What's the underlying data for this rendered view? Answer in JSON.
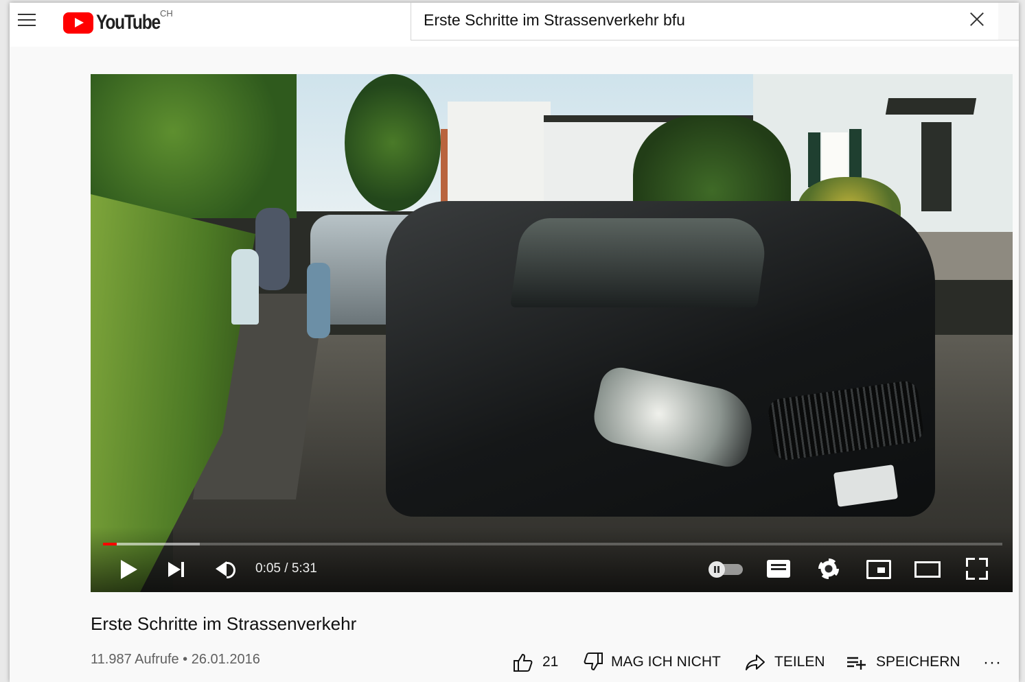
{
  "header": {
    "logo_text": "YouTube",
    "country_code": "CH",
    "search_query": "Erste Schritte im Strassenverkehr bfu",
    "icons": [
      "menu-icon",
      "youtube-logo",
      "close-icon"
    ]
  },
  "player": {
    "time_display": "0:05 / 5:31",
    "current_time": "0:05",
    "duration": "5:31",
    "progress_fraction": 0.0151,
    "buffered_fraction": 0.108,
    "accent_color": "#ff0000",
    "controls": [
      "play-icon",
      "next-icon",
      "volume-icon",
      "autoplay-toggle",
      "subtitles-icon",
      "settings-icon",
      "miniplayer-icon",
      "theater-icon",
      "fullscreen-icon"
    ]
  },
  "video_info": {
    "title": "Erste Schritte im Strassenverkehr",
    "views": "11.987 Aufrufe",
    "separator": "•",
    "date": "26.01.2016",
    "meta_line": "11.987 Aufrufe • 26.01.2016"
  },
  "actions": {
    "like_count": "21",
    "dislike_label": "MAG ICH NICHT",
    "share_label": "TEILEN",
    "save_label": "SPEICHERN",
    "more_label": "···"
  }
}
